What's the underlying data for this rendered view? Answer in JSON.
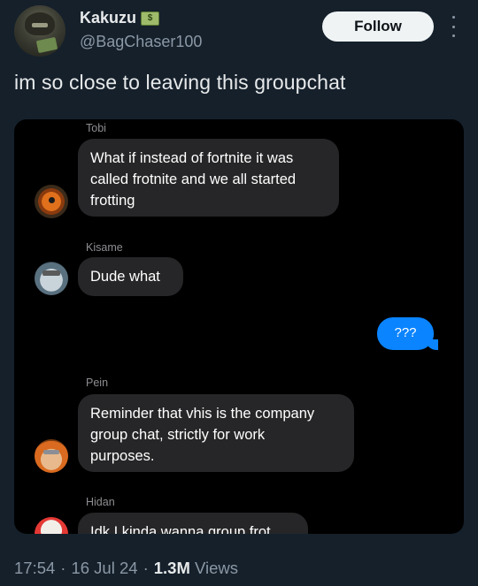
{
  "author": {
    "display_name": "Kakuzu",
    "name_emoji": "$",
    "handle": "@BagChaser100"
  },
  "header": {
    "follow_label": "Follow"
  },
  "tweet": {
    "text": "im so close to leaving this groupchat"
  },
  "chat": {
    "messages": [
      {
        "sender": "Tobi",
        "text": "What if instead of fortnite it was\ncalled frotnite and we all started\nfrotting"
      },
      {
        "sender": "Kisame",
        "text": "Dude what"
      },
      {
        "sender": "",
        "text": "???"
      },
      {
        "sender": "Pein",
        "text": "Reminder that vhis is the company\ngroup chat, strictly for work\npurposes."
      },
      {
        "sender": "Hidan",
        "text": "Idk I kinda wanna group frot"
      }
    ]
  },
  "meta": {
    "time": "17:54",
    "date": "16 Jul 24",
    "views_count": "1.3M",
    "views_label": "Views",
    "separator": "·"
  },
  "colors": {
    "background": "#15202b",
    "bubble_incoming": "#262628",
    "bubble_outgoing": "#0a84ff"
  }
}
